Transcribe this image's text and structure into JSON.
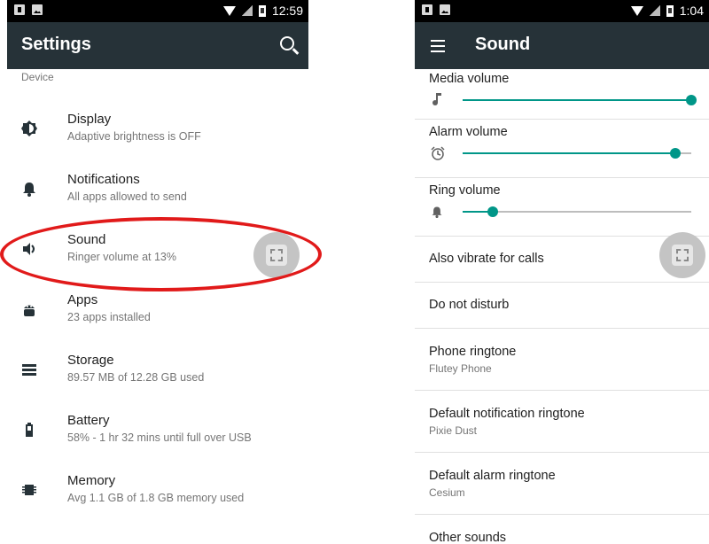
{
  "left_screen": {
    "status": {
      "time": "12:59"
    },
    "appbar": {
      "title": "Settings"
    },
    "category": "Device",
    "items": [
      {
        "title": "Display",
        "subtitle": "Adaptive brightness is OFF",
        "icon": "brightness-icon"
      },
      {
        "title": "Notifications",
        "subtitle": "All apps allowed to send",
        "icon": "bell-icon"
      },
      {
        "title": "Sound",
        "subtitle": "Ringer volume at 13%",
        "icon": "volume-icon"
      },
      {
        "title": "Apps",
        "subtitle": "23 apps installed",
        "icon": "android-icon"
      },
      {
        "title": "Storage",
        "subtitle": "89.57 MB of 12.28 GB used",
        "icon": "storage-icon"
      },
      {
        "title": "Battery",
        "subtitle": "58% - 1 hr 32 mins until full over USB",
        "icon": "battery-icon"
      },
      {
        "title": "Memory",
        "subtitle": "Avg 1.1 GB of 1.8 GB memory used",
        "icon": "memory-icon"
      }
    ]
  },
  "right_screen": {
    "status": {
      "time": "1:04"
    },
    "appbar": {
      "title": "Sound"
    },
    "volumes": [
      {
        "label": "Media volume",
        "level": 1.0,
        "icon": "music-note-icon"
      },
      {
        "label": "Alarm volume",
        "level": 0.93,
        "icon": "alarm-clock-icon"
      },
      {
        "label": "Ring volume",
        "level": 0.13,
        "icon": "bell-icon"
      }
    ],
    "rows": [
      {
        "title": "Also vibrate for calls",
        "subtitle": ""
      },
      {
        "title": "Do not disturb",
        "subtitle": ""
      },
      {
        "title": "Phone ringtone",
        "subtitle": "Flutey Phone"
      },
      {
        "title": "Default notification ringtone",
        "subtitle": "Pixie Dust"
      },
      {
        "title": "Default alarm ringtone",
        "subtitle": "Cesium"
      },
      {
        "title": "Other sounds",
        "subtitle": ""
      }
    ]
  },
  "colors": {
    "appbar": "#263238",
    "accent": "#009688",
    "highlight": "#e11a1a"
  }
}
